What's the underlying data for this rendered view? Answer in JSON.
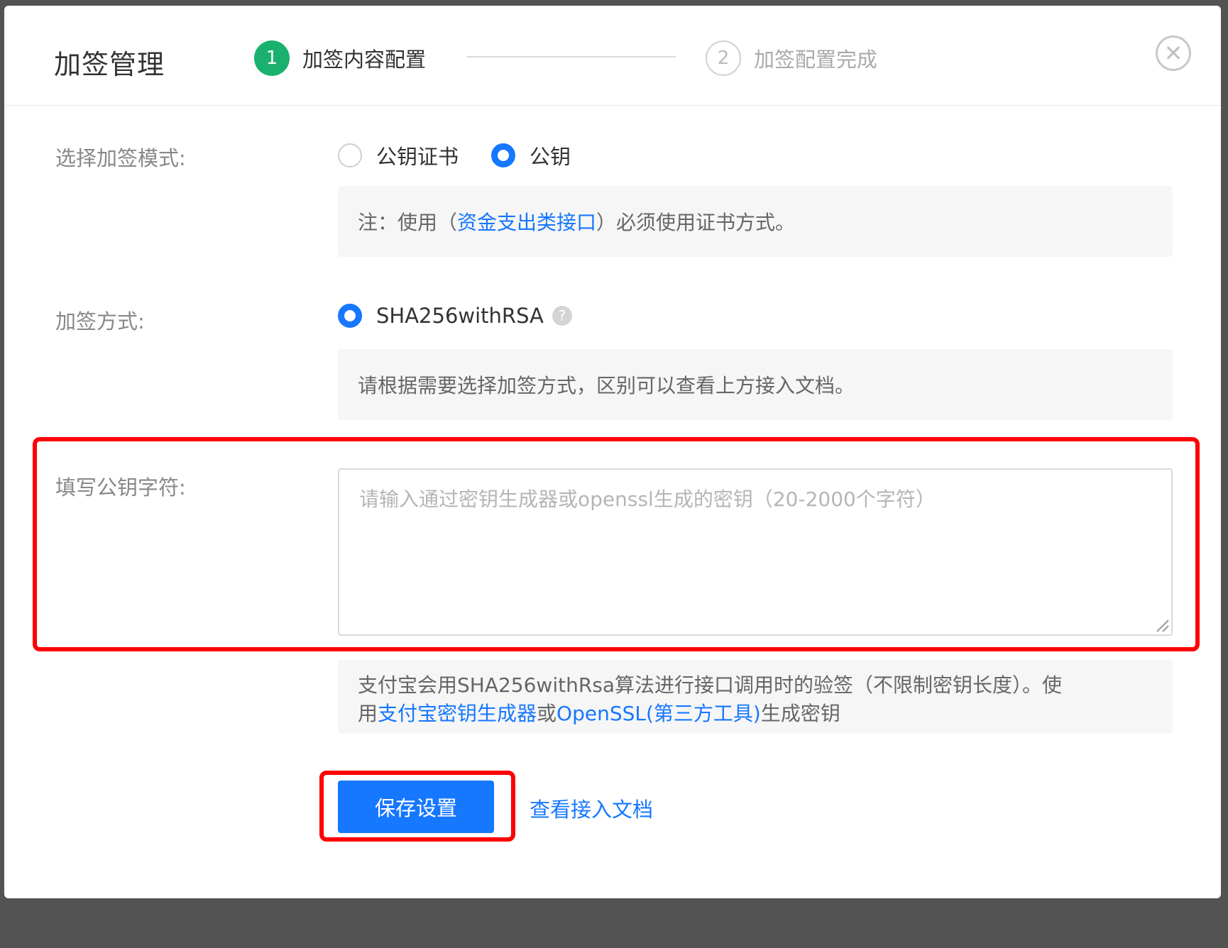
{
  "dialog": {
    "title": "加签管理",
    "close_icon": "close-circle-icon"
  },
  "steps": [
    {
      "number": "1",
      "label": "加签内容配置",
      "state": "active"
    },
    {
      "number": "2",
      "label": "加签配置完成",
      "state": "pending"
    }
  ],
  "sign_mode": {
    "label": "选择加签模式:",
    "options": [
      {
        "label": "公钥证书",
        "checked": false
      },
      {
        "label": "公钥",
        "checked": true
      }
    ],
    "note_prefix": "注：使用（",
    "note_link": "资金支出类接口",
    "note_suffix": "）必须使用证书方式。"
  },
  "sign_method": {
    "label": "加签方式:",
    "option": "SHA256withRSA",
    "help_icon": "question-circle-icon",
    "note": "请根据需要选择加签方式，区别可以查看上方接入文档。"
  },
  "public_key": {
    "label": "填写公钥字符:",
    "placeholder": "请输入通过密钥生成器或openssl生成的密钥（20-2000个字符）",
    "value": ""
  },
  "info": {
    "line1": "支付宝会用SHA256withRsa算法进行接口调用时的验签（不限制密钥长度）。使",
    "line2_prefix": "用",
    "link1": "支付宝密钥生成器",
    "mid": "或",
    "link2": "OpenSSL(第三方工具)",
    "line2_suffix": "生成密钥"
  },
  "actions": {
    "save_label": "保存设置",
    "doc_link": "查看接入文档"
  },
  "colors": {
    "primary": "#1677ff",
    "step_active": "#1ab16e",
    "highlight": "#ff0000",
    "backdrop": "#535353"
  }
}
